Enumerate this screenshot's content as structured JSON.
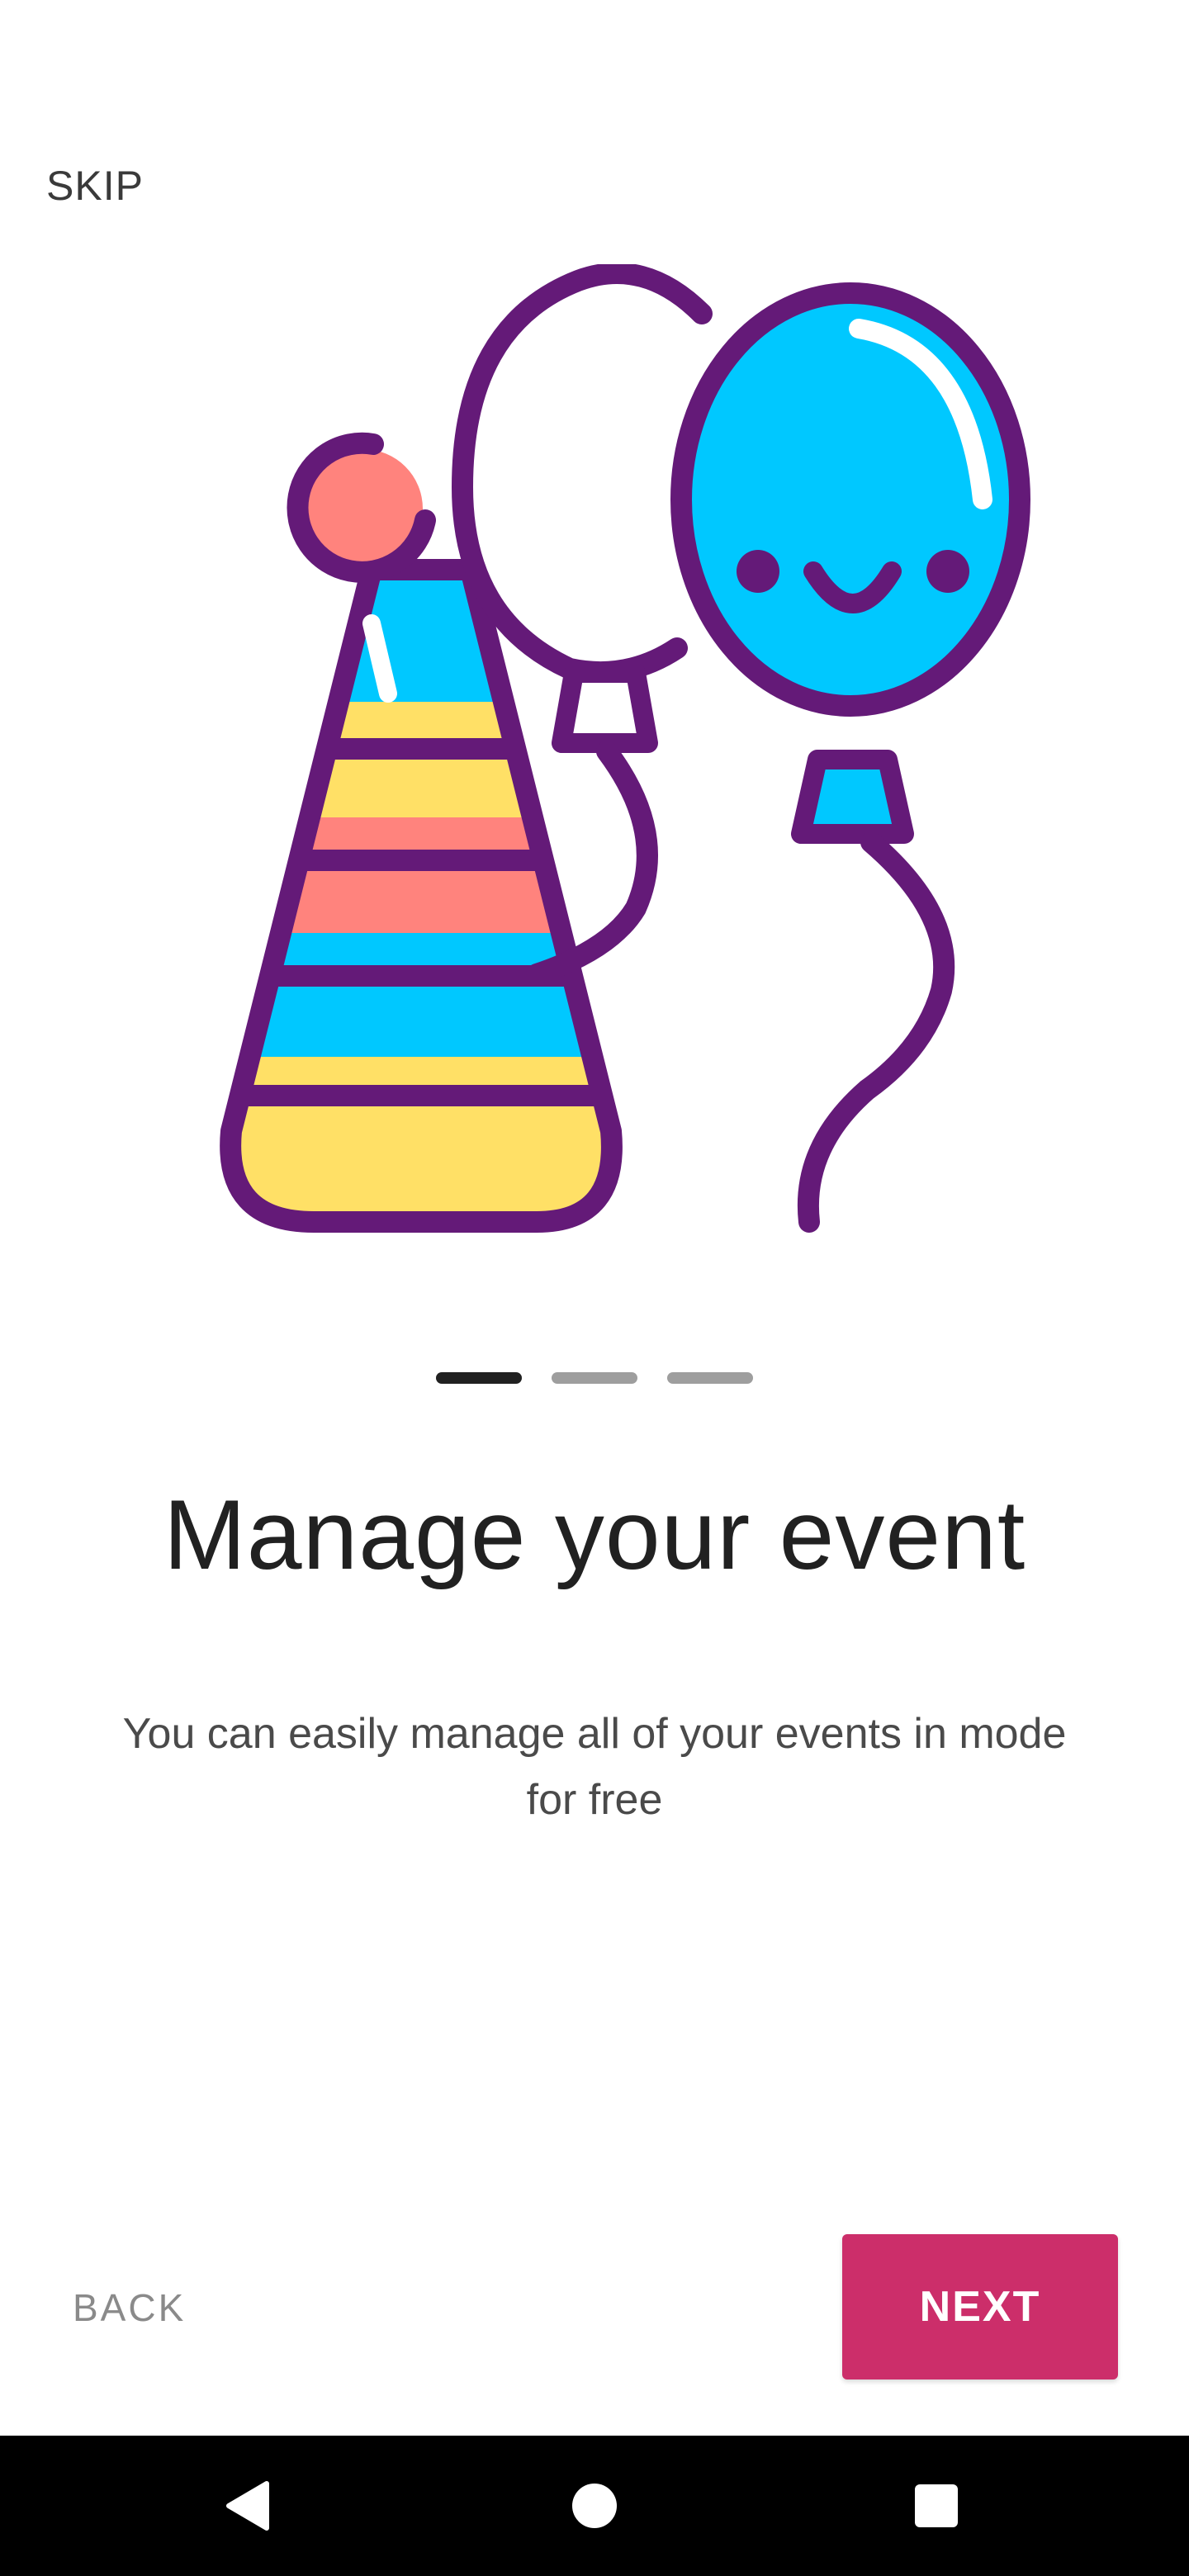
{
  "onboarding": {
    "skip_label": "SKIP",
    "title": "Manage your event",
    "description": "You can easily manage all of your events in mode for free",
    "back_label": "BACK",
    "next_label": "NEXT",
    "page_indicator": {
      "total": 3,
      "current": 1
    }
  },
  "illustration": {
    "icons": [
      "party-hat-icon",
      "balloon-outline-icon",
      "balloon-smiley-icon"
    ]
  },
  "colors": {
    "accent": "#cc2e6a",
    "outline": "#641a78",
    "balloon_blue": "#00c8ff",
    "hat_yellow": "#ffe066",
    "hat_pink": "#ff837d"
  },
  "navbar": {
    "icons": [
      "back-triangle-icon",
      "home-circle-icon",
      "recents-square-icon"
    ]
  }
}
